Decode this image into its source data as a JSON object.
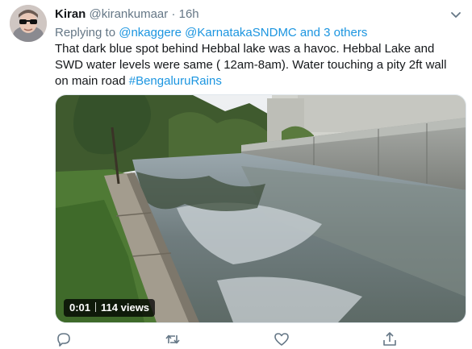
{
  "tweet": {
    "author_name": "Kiran",
    "author_handle": "@kirankumaar",
    "separator": "·",
    "timestamp": "16h",
    "reply_prefix": "Replying to",
    "reply_mentions": "@nkaggere @KarnatakaSNDMC and 3 others",
    "text": "That dark blue spot behind Hebbal lake was a havoc. Hebbal Lake and SWD water levels were same ( 12am-8am). Water touching a pity 2ft wall on main road",
    "hashtag": "#BengaluruRains"
  },
  "video": {
    "duration": "0:01",
    "views": "114 views"
  },
  "icons": {
    "more": "chevron-down-icon",
    "reply": "reply-icon",
    "retweet": "retweet-icon",
    "like": "heart-icon",
    "share": "share-icon",
    "avatar": "avatar-sunglasses"
  },
  "colors": {
    "link": "#1b95e0",
    "secondary_text": "#657786",
    "primary_text": "#14171a"
  }
}
